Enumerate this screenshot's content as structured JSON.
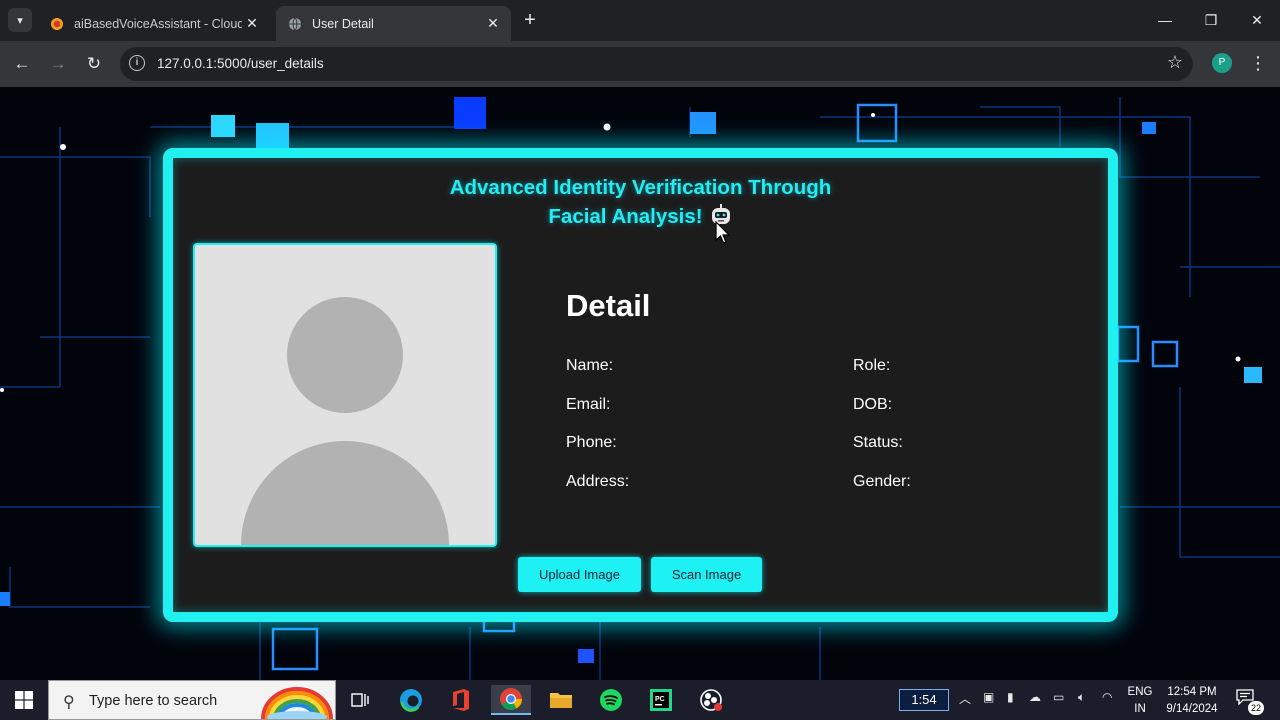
{
  "browser": {
    "tabs": [
      {
        "title": "aiBasedVoiceAssistant - Cloud I",
        "active": false
      },
      {
        "title": "User Detail",
        "active": true
      }
    ],
    "url": "127.0.0.1:5000/user_details",
    "profile_initial": "P"
  },
  "page": {
    "title_line1": "Advanced Identity Verification Through",
    "title_line2": "Facial Analysis!",
    "detail_heading": "Detail",
    "fields_left": [
      "Name:",
      "Email:",
      "Phone:",
      "Address:"
    ],
    "fields_right": [
      "Role:",
      "DOB:",
      "Status:",
      "Gender:"
    ],
    "upload_button": "Upload Image",
    "scan_button": "Scan Image",
    "accent_color": "#21f0f0"
  },
  "taskbar": {
    "search_placeholder": "Type here to search",
    "timer": "1:54",
    "lang_line1": "ENG",
    "lang_line2": "IN",
    "time": "12:54 PM",
    "date": "9/14/2024",
    "notification_count": "22"
  }
}
